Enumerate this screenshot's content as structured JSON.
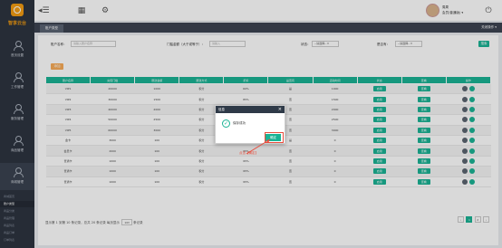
{
  "sidebar": {
    "logo_text": "智享云台",
    "nav": [
      {
        "label": "首页设置"
      },
      {
        "label": "工作管理"
      },
      {
        "label": "服务管理"
      },
      {
        "label": "商品管理"
      },
      {
        "label": "商城管理"
      }
    ],
    "sub_items": [
      "商城首页",
      "账户类型",
      "商品分类",
      "商品管理",
      "商品列表",
      "商品订单",
      "订单列表"
    ]
  },
  "topbar": {
    "menu_icon": "collapse-menu-icon",
    "grid_icon": "grid-icon",
    "settings_icon": "gear-icon",
    "user_name": "周周",
    "user_role": "会员(普通版)",
    "power_icon": "power-icon"
  },
  "tabs": {
    "active": "账户类型",
    "operations": "关闭操作"
  },
  "filters": {
    "account_label": "账户名称：",
    "account_placeholder": "请输入账户名称",
    "threshold_label": "门槛金额（大于或等于）：",
    "threshold_placeholder": "请输入",
    "status_label": "状态：",
    "status_value": "--请选择--",
    "type_label": "是否有：",
    "type_value": "--请选择--",
    "search_button": "搜索"
  },
  "add_button": "添加",
  "table": {
    "headers": [
      "账户名称",
      "充值门槛",
      "赠送金额",
      "赠送方式",
      "折扣",
      "是否有",
      "活动时间",
      "状态",
      "查看",
      "操作"
    ],
    "rows": [
      {
        "name": "VIP1",
        "threshold": "20000",
        "gift": "1000",
        "method": "积分",
        "discount": "60%",
        "has": "是",
        "time": "1000",
        "status": "启用",
        "view": "查看"
      },
      {
        "name": "VIP2",
        "threshold": "30000",
        "gift": "1500",
        "method": "积分",
        "discount": "85%",
        "has": "否",
        "time": "1500",
        "status": "启用",
        "view": "查看"
      },
      {
        "name": "VIP3",
        "threshold": "40000",
        "gift": "2000",
        "method": "积分",
        "discount": "80%",
        "has": "否",
        "time": "2000",
        "status": "启用",
        "view": "查看"
      },
      {
        "name": "VIP4",
        "threshold": "50000",
        "gift": "2500",
        "method": "积分",
        "discount": "75%",
        "has": "否",
        "time": "2500",
        "status": "启用",
        "view": "查看"
      },
      {
        "name": "VIP5",
        "threshold": "60000",
        "gift": "3000",
        "method": "积分",
        "discount": "70%",
        "has": "否",
        "time": "3000",
        "status": "启用",
        "view": "查看"
      },
      {
        "name": "金卡",
        "threshold": "3000",
        "gift": "100",
        "method": "积分",
        "discount": "95%",
        "has": "是",
        "time": "0",
        "status": "启用",
        "view": "查看"
      },
      {
        "name": "会员卡",
        "threshold": "2000",
        "gift": "100",
        "method": "积分",
        "discount": "95%",
        "has": "否",
        "time": "0",
        "status": "启用",
        "view": "查看"
      },
      {
        "name": "普通卡",
        "threshold": "1000",
        "gift": "100",
        "method": "积分",
        "discount": "95%",
        "has": "否",
        "time": "0",
        "status": "启用",
        "view": "查看"
      },
      {
        "name": "普通卡",
        "threshold": "1000",
        "gift": "100",
        "method": "积分",
        "discount": "95%",
        "has": "否",
        "time": "0",
        "status": "启用",
        "view": "查看"
      },
      {
        "name": "普通卡",
        "threshold": "1000",
        "gift": "100",
        "method": "积分",
        "discount": "95%",
        "has": "否",
        "time": "0",
        "status": "启用",
        "view": "查看"
      }
    ]
  },
  "pager": {
    "info": "显示第 1 到第 10 条记录，总共 20 条记录 每页显示",
    "page_size": "10",
    "suffix": "条记录",
    "pages": [
      "‹",
      "1",
      "2",
      "›"
    ]
  },
  "dialog": {
    "title": "信息",
    "close_icon": "close-icon",
    "message": "保存成功",
    "ok_button": "确定",
    "hint": "点击【确定】"
  }
}
